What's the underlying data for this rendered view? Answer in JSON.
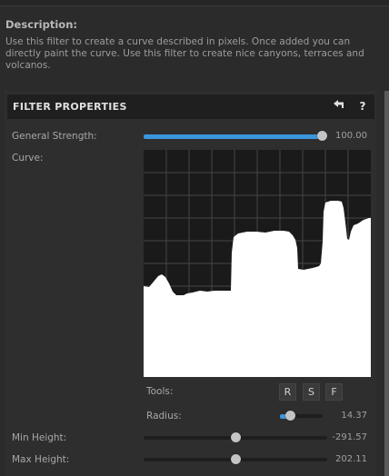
{
  "description": {
    "heading": "Description:",
    "text": "Use this filter to create a curve described in pixels. Once added you can directly paint the curve. Use this filter to create nice canyons, terraces and volcanos."
  },
  "panel": {
    "title": "FILTER PROPERTIES",
    "back_icon": "back-arrow-icon",
    "help_label": "?"
  },
  "general_strength": {
    "label": "General Strength:",
    "value": "100.00",
    "level": 1.0
  },
  "curve": {
    "label": "Curve:"
  },
  "tools": {
    "label": "Tools:",
    "buttons": [
      {
        "label": "R"
      },
      {
        "label": "S"
      },
      {
        "label": "F"
      }
    ]
  },
  "radius": {
    "label": "Radius:",
    "value": "14.37",
    "level": 0.25
  },
  "min_height": {
    "label": "Min Height:",
    "value": "-291.57",
    "level": 0.5
  },
  "max_height": {
    "label": "Max Height:",
    "value": "202.11",
    "level": 0.5
  },
  "colors": {
    "accent": "#3a96dd",
    "background": "#2b2b2b",
    "header": "#1f1f1f"
  }
}
